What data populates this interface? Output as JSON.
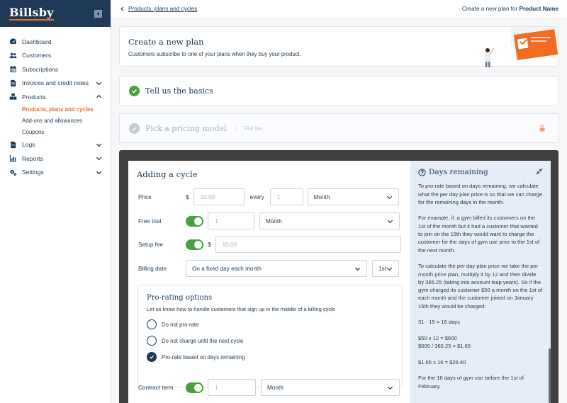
{
  "brand": {
    "name": "Billsby"
  },
  "sidebar": {
    "items": [
      {
        "label": "Dashboard",
        "icon": "dashboard-icon"
      },
      {
        "label": "Customers",
        "icon": "users-icon"
      },
      {
        "label": "Subscriptions",
        "icon": "calendar-icon"
      },
      {
        "label": "Invoices and credit notes",
        "icon": "invoice-icon",
        "chevron": "down"
      },
      {
        "label": "Products",
        "icon": "boxes-icon",
        "chevron": "up"
      },
      {
        "label": "Logs",
        "icon": "file-icon",
        "chevron": "down"
      },
      {
        "label": "Reports",
        "icon": "chart-icon",
        "chevron": "down"
      },
      {
        "label": "Settings",
        "icon": "gears-icon",
        "chevron": "down"
      }
    ],
    "products_sub": [
      {
        "label": "Products, plans and cycles",
        "active": true
      },
      {
        "label": "Add-ons and allowances",
        "active": false
      },
      {
        "label": "Coupons",
        "active": false
      }
    ]
  },
  "topbar": {
    "breadcrumb": "Products, plans and cycles",
    "context_prefix": "Create a new plan for",
    "context_product": "Product Name"
  },
  "intro": {
    "title": "Create a new plan",
    "subtitle": "Customers subscribe to one of your plans when they buy your product."
  },
  "steps": {
    "basics": "Tell us the basics",
    "pricing": "Pick a pricing model",
    "pricing_tag": "Flat fee"
  },
  "cycle": {
    "title": "Adding a cycle",
    "price_label": "Price",
    "currency": "$",
    "price_placeholder": "10.00",
    "every_label": "every",
    "every_placeholder": "1",
    "every_unit": "Month",
    "free_trial_label": "Free trial",
    "free_trial_placeholder": "1",
    "free_trial_unit": "Month",
    "setup_fee_label": "Setup fee",
    "setup_fee_placeholder": "10.00",
    "billing_date_label": "Billing date",
    "billing_date_value": "On a fixed day each month",
    "billing_day_value": "1st",
    "contract_label": "Contract term",
    "contract_placeholder": "1",
    "contract_unit": "Month"
  },
  "prorate": {
    "title": "Pro-rating options",
    "description": "Let us know how to handle customers that sign up in the middle of a billing cycle",
    "options": [
      {
        "label": "Do not pro-rate",
        "selected": false
      },
      {
        "label": "Do not charge until the next cycle",
        "selected": false
      },
      {
        "label": "Pro-rate based on days remaining",
        "selected": true
      }
    ]
  },
  "help": {
    "title": "Days remaining",
    "paragraphs": [
      "To pro-rate based on days remaining, we calculate what the per day plan price is so that we can charge for the remaining days in the month.",
      "For example, if. a gym billed its customers on the 1st of the month but it had a customer that wanted to join on the 15th they would want to charge the customer for the days of gym use prior to the 1st of the next month.",
      "To calculate the per day plan price we take the per month price plan, multiply it by 12 and then divide by 365.25 (taking into account leap years). So if the gym charged its customer $50 a month on the 1st of each month and the customer joined on January 15th they would be charged:",
      "31 - 15 = 16 days",
      "$50 x 12 = $600",
      "$600 / 365.25 = $1.65",
      "$1.65 x 16 = $26.40",
      "For the 16 days of gym use before the 1st of February."
    ]
  },
  "colors": {
    "navy": "#1e3a56",
    "accent": "#f26c23",
    "success": "#48a03f"
  }
}
